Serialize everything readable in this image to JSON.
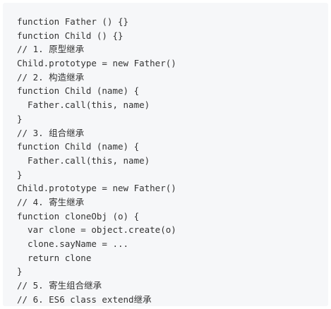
{
  "code": {
    "lines": [
      "function Father () {}",
      "function Child () {}",
      "// 1. 原型继承",
      "Child.prototype = new Father()",
      "// 2. 构造继承",
      "function Child (name) {",
      "  Father.call(this, name)",
      "}",
      "// 3. 组合继承",
      "function Child (name) {",
      "  Father.call(this, name)",
      "}",
      "Child.prototype = new Father()",
      "// 4. 寄生继承",
      "function cloneObj (o) {",
      "  var clone = object.create(o)",
      "  clone.sayName = ...",
      "  return clone",
      "}",
      "// 5. 寄生组合继承",
      "// 6. ES6 class extend继承"
    ]
  },
  "colors": {
    "background": "#f6f7f9",
    "text": "#333333"
  }
}
